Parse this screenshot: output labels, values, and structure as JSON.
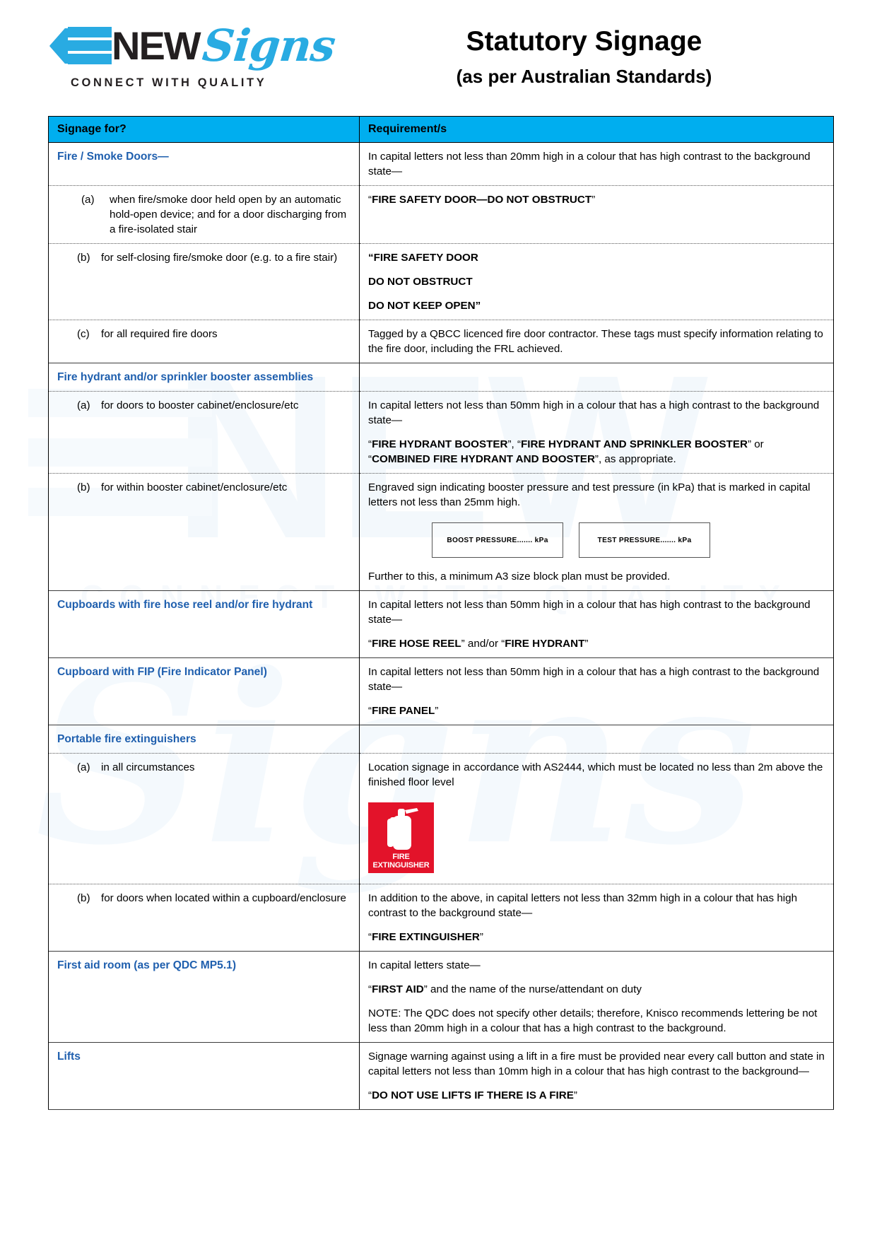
{
  "brand": {
    "word": "NEW",
    "script": "Signs",
    "tagline": "CONNECT WITH QUALITY",
    "accent_color": "#29ABE2",
    "dark_blue": "#1B5FA8"
  },
  "header": {
    "title": "Statutory Signage",
    "subtitle": "(as per Australian Standards)"
  },
  "table": {
    "header_color": "#00AEEF",
    "section_color": "#1F5FAE",
    "columns": [
      "Signage for?",
      "Requirement/s"
    ],
    "rows": [
      {
        "id": "fire-smoke-doors",
        "type": "section",
        "left_title": "Fire / Smoke Doors—",
        "right": [
          "In capital letters not less than 20mm high in a colour that has high contrast to the background state—"
        ]
      },
      {
        "id": "fire-smoke-doors-a",
        "type": "sub",
        "marker": "(a)",
        "left": "when fire/smoke door held open by an automatic hold-open device; and for a door discharging from a fire-isolated stair",
        "right_bold": "“FIRE SAFETY DOOR—DO NOT OBSTRUCT”"
      },
      {
        "id": "fire-smoke-doors-b",
        "type": "sub",
        "marker": "(b)",
        "left": "for self-closing fire/smoke door (e.g. to a fire stair)",
        "right_lines": [
          "“FIRE SAFETY DOOR",
          " DO NOT OBSTRUCT",
          " DO NOT KEEP OPEN”"
        ]
      },
      {
        "id": "fire-smoke-doors-c",
        "type": "sub",
        "marker": "(c)",
        "left": "for all required fire doors",
        "right": [
          "Tagged by a QBCC licenced fire door contractor.  These tags must specify information relating to the fire door, including the FRL achieved."
        ]
      },
      {
        "id": "booster-assemblies",
        "type": "section",
        "left_title": "Fire hydrant and/or sprinkler booster assemblies",
        "right": []
      },
      {
        "id": "booster-a",
        "type": "sub",
        "marker": "(a)",
        "left": "for doors to booster cabinet/enclosure/etc",
        "right": [
          "In capital letters not less than 50mm high in a colour that has a high contrast to the background state—"
        ],
        "right_mixed": "“FIRE HYDRANT BOOSTER”, “FIRE HYDRANT AND SPRINKLER BOOSTER” or “COMBINED FIRE HYDRANT AND BOOSTER”, as appropriate."
      },
      {
        "id": "booster-b",
        "type": "sub",
        "marker": "(b)",
        "left": "for within booster cabinet/enclosure/etc",
        "right": [
          "Engraved sign indicating booster pressure and test pressure (in kPa) that is marked in capital letters not less than 25mm high."
        ],
        "sign_boxes": [
          "BOOST PRESSURE....... kPa",
          "TEST PRESSURE....... kPa"
        ],
        "right_after": "Further to this, a minimum A3 size block plan must be provided."
      },
      {
        "id": "cupboards-hose-reel",
        "type": "section",
        "left_title": "Cupboards with fire hose reel and/or fire hydrant",
        "right": [
          "In capital letters not less than 50mm high in a colour that has high contrast to the background state—"
        ],
        "right_mixed": "“FIRE HOSE REEL” and/or “FIRE HYDRANT”"
      },
      {
        "id": "cupboard-fip",
        "type": "section",
        "left_title": "Cupboard with FIP (Fire Indicator Panel)",
        "right": [
          "In capital letters not less than 50mm high in a colour that has a high contrast to the background state—"
        ],
        "right_bold": "“FIRE PANEL”"
      },
      {
        "id": "portable-fire-extinguishers",
        "type": "section",
        "left_title": "Portable fire extinguishers",
        "right": []
      },
      {
        "id": "extinguisher-a",
        "type": "sub",
        "marker": "(a)",
        "left": "in all circumstances",
        "right": [
          "Location signage in accordance with AS2444, which must be located no less than 2m above the finished floor level"
        ],
        "sign_image": {
          "name": "fire-extinguisher-sign",
          "line1": "FIRE",
          "line2": "EXTINGUISHER",
          "bg_color": "#E3132A"
        }
      },
      {
        "id": "extinguisher-b",
        "type": "sub",
        "marker": "(b)",
        "left": "for doors when located within a cupboard/enclosure",
        "right": [
          "In addition to the above, in capital letters not less than 32mm high in a colour that has high contrast to the background state—"
        ],
        "right_bold": "“FIRE EXTINGUISHER”"
      },
      {
        "id": "first-aid-room",
        "type": "section",
        "left_title": "First aid room (as per QDC MP5.1)",
        "right": [
          "In capital letters state—"
        ],
        "right_mixed": "“FIRST AID” and the name of the nurse/attendant on duty",
        "right_after": "NOTE: The QDC does not specify other details; therefore, Knisco recommends lettering be not less than 20mm high in a colour that has a high contrast to the background."
      },
      {
        "id": "lifts",
        "type": "section",
        "left_title": "Lifts",
        "right": [
          "Signage warning against using a lift in a fire must be provided near every call button and state in capital letters not less than 10mm high in a colour that has high contrast to the background—"
        ],
        "right_bold": "“DO NOT USE LIFTS IF THERE IS A FIRE”"
      }
    ]
  }
}
